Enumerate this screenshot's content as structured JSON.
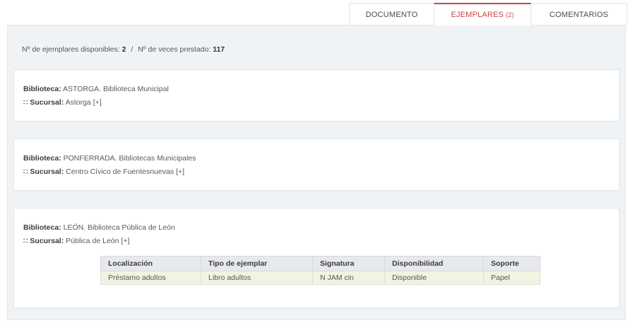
{
  "tabs": [
    {
      "label": "DOCUMENTO"
    },
    {
      "label": "EJEMPLARES",
      "count": "(2)"
    },
    {
      "label": "COMENTARIOS"
    }
  ],
  "summary": {
    "available_label": "Nº de ejemplares disponibles:",
    "available_value": "2",
    "separator": "/",
    "loans_label": "Nº de veces prestado:",
    "loans_value": "117"
  },
  "libraries": [
    {
      "biblioteca_label": "Biblioteca:",
      "biblioteca": "ASTORGA. Biblioteca Municipal",
      "sucursal_label": "Sucursal:",
      "sucursal": "Astorga",
      "expand": "[+]"
    },
    {
      "biblioteca_label": "Biblioteca:",
      "biblioteca": "PONFERRADA. Bibliotecas Municipales",
      "sucursal_label": "Sucursal:",
      "sucursal": "Centro Cívico de Fuentesnuevas",
      "expand": "[+]"
    },
    {
      "biblioteca_label": "Biblioteca:",
      "biblioteca": "LEÓN. Biblioteca Pública de León",
      "sucursal_label": "Sucursal:",
      "sucursal": "Pública de León",
      "expand": "[+]"
    }
  ],
  "items_table": {
    "headers": [
      "Localización",
      "Tipo de ejemplar",
      "Signatura",
      "Disponibilidad",
      "Soporte"
    ],
    "rows": [
      [
        "Préstamo adultos",
        "Libro adultos",
        "N JAM cin",
        "Disponible",
        "Papel"
      ]
    ]
  },
  "colors": {
    "active_tab": "#d04545",
    "bullet": "#2f6fb0",
    "panel_bg": "#f0f3f6",
    "row_bg": "#f3f3e3"
  },
  "icons": {
    "sucursal_bullet": "grid-dots-icon"
  }
}
